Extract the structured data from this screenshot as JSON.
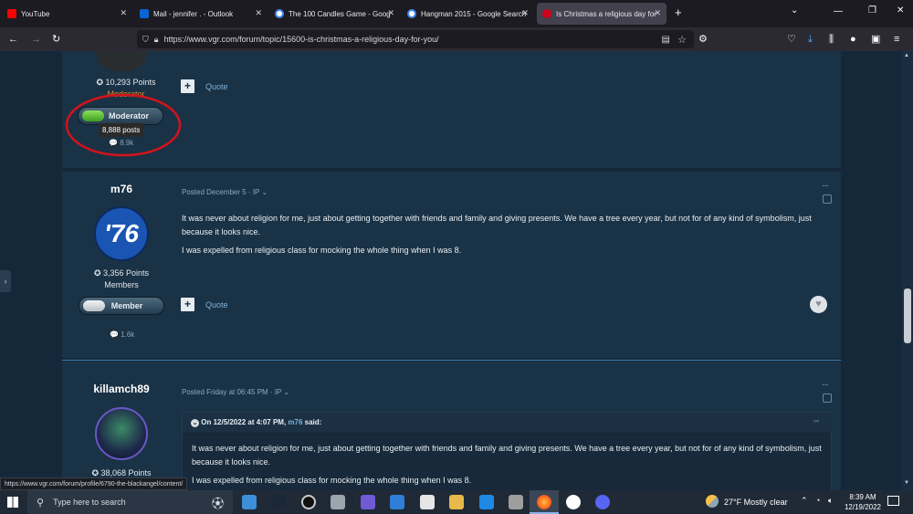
{
  "browser": {
    "tabs": [
      {
        "label": "YouTube",
        "color": "#ff0000"
      },
      {
        "label": "Mail - jennifer . - Outlook",
        "color": "#0a64d2"
      },
      {
        "label": "The 100 Candles Game - Goog",
        "color": "#4285f4"
      },
      {
        "label": "Hangman 2015 - Google Search",
        "color": "#4285f4"
      },
      {
        "label": "Is Christmas a religious day for",
        "color": "#d0021b"
      }
    ],
    "new_tab": "+",
    "url": "https://www.vgr.com/forum/topic/15600-is-christmas-a-religious-day-for-you/"
  },
  "posts": [
    {
      "points": "10,293 Points",
      "role": "Moderator",
      "badge": "Moderator",
      "tooltip": "8,888 posts",
      "postcount": "8.9k",
      "quote_label": "Quote"
    },
    {
      "author": "m76",
      "avatar_text": "'76",
      "meta": "Posted December 5 · IP",
      "paragraphs": [
        "It was never about religion for me, just about getting together with friends and family and giving presents. We have a tree every year, but not for of any kind of symbolism, just because it looks nice.",
        "I was expelled from religious class for mocking the whole thing when I was 8."
      ],
      "points": "3,356 Points",
      "role": "Members",
      "badge": "Member",
      "postcount": "1.6k",
      "quote_label": "Quote"
    },
    {
      "author": "killamch89",
      "meta": "Posted Friday at 06:45 PM · IP",
      "quote_header": "On 12/5/2022 at 4:07 PM,",
      "quote_user": "m76",
      "quote_said": "said:",
      "quote_paragraphs": [
        "It was never about religion for me, just about getting together with friends and family and giving presents. We have a tree every year, but not for of any kind of symbolism, just because it looks nice.",
        "I was expelled from religious class for mocking the whole thing when I was 8."
      ],
      "points": "38,068 Points"
    }
  ],
  "status_url": "https://www.vgr.com/forum/profile/6790-the-blackangel/content/",
  "taskbar": {
    "search_placeholder": "Type here to search",
    "weather": "27°F  Mostly clear",
    "time": "8:39 AM",
    "date": "12/19/2022"
  },
  "colors": {
    "accent": "#7fb2dc",
    "annotation": "#d2131c",
    "page_bg": "#15283a"
  }
}
